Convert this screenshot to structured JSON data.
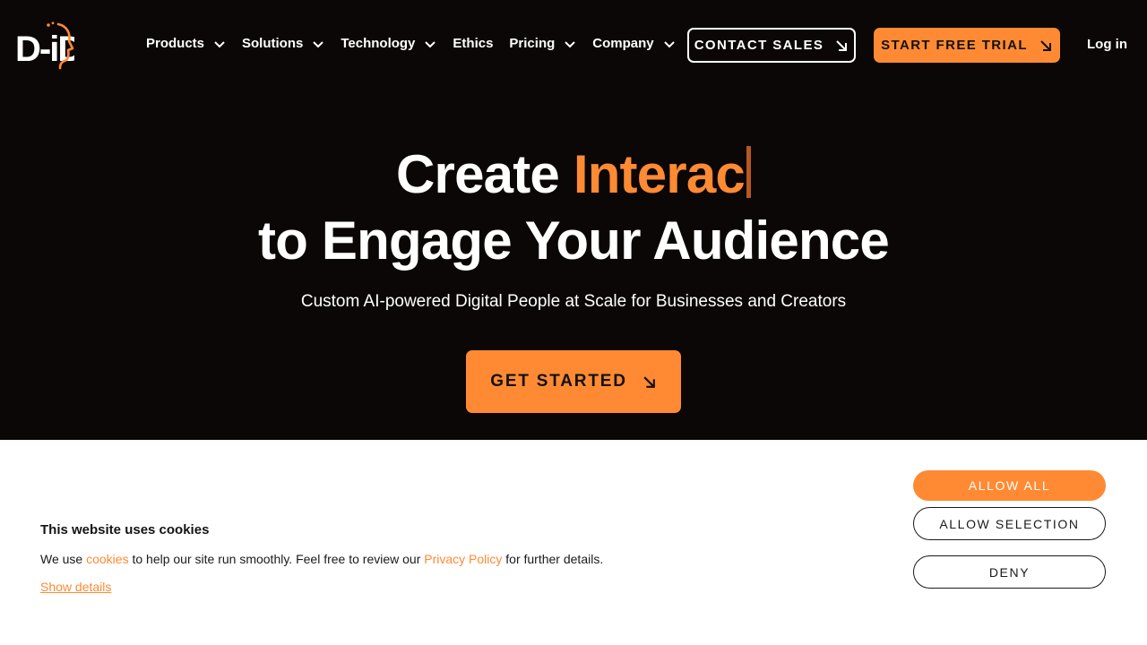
{
  "brand": {
    "logo_text": "D-iD",
    "accent_color": "#ff8a33"
  },
  "nav": {
    "items": [
      {
        "label": "Products",
        "has_dropdown": true
      },
      {
        "label": "Solutions",
        "has_dropdown": true
      },
      {
        "label": "Technology",
        "has_dropdown": true
      },
      {
        "label": "Ethics",
        "has_dropdown": false
      },
      {
        "label": "Pricing",
        "has_dropdown": true
      },
      {
        "label": "Company",
        "has_dropdown": true
      }
    ],
    "contact_sales": "CONTACT SALES",
    "start_trial": "START FREE TRIAL",
    "login": "Log in"
  },
  "hero": {
    "title_prefix": "Create ",
    "title_typed": "Interac",
    "title_line2": "to Engage Your Audience",
    "subtitle": "Custom AI-powered Digital People at Scale for Businesses and Creators",
    "cta": "GET STARTED"
  },
  "cookie_banner": {
    "title": "This website uses cookies",
    "text_1": "We use ",
    "link_cookies": "cookies",
    "text_2": " to help our site run smoothly. Feel free to review our ",
    "link_privacy": "Privacy Policy",
    "text_3": " for further details.",
    "show_details": "Show details",
    "allow_all": "ALLOW ALL",
    "allow_selection": "ALLOW SELECTION",
    "deny": "DENY"
  }
}
